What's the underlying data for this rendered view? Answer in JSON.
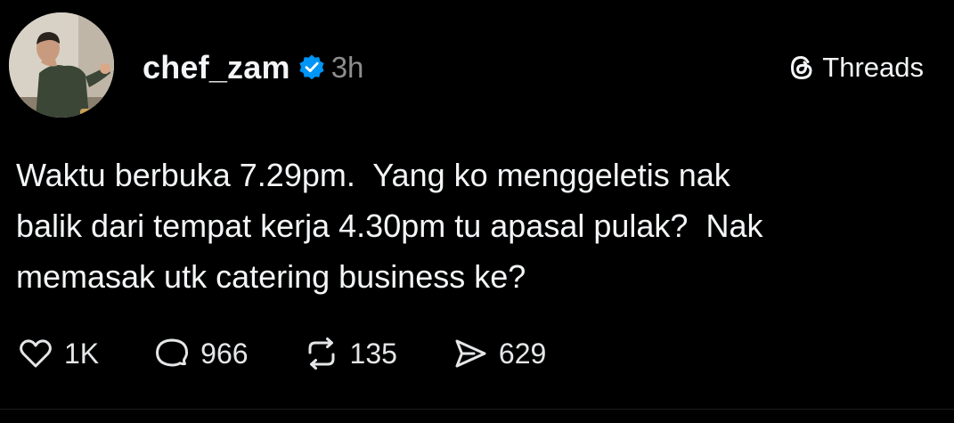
{
  "post": {
    "author": {
      "username": "chef_zam",
      "verified": true,
      "time_ago": "3h",
      "avatar_icon": "avatar-photo"
    },
    "platform": {
      "name": "Threads",
      "icon": "threads-logo-icon"
    },
    "text_lines": [
      "Waktu berbuka 7.29pm.  Yang ko menggeletis nak",
      "balik dari tempat kerja 4.30pm tu apasal pulak?  Nak",
      "memasak utk catering business ke?"
    ],
    "actions": {
      "like": {
        "icon": "heart-icon",
        "count": "1K"
      },
      "reply": {
        "icon": "comment-icon",
        "count": "966"
      },
      "repost": {
        "icon": "repost-icon",
        "count": "135"
      },
      "share": {
        "icon": "send-icon",
        "count": "629"
      }
    },
    "colors": {
      "background": "#000000",
      "text": "#f3f5f7",
      "muted": "#8e8e8e",
      "verified_badge": "#0095f6"
    }
  }
}
